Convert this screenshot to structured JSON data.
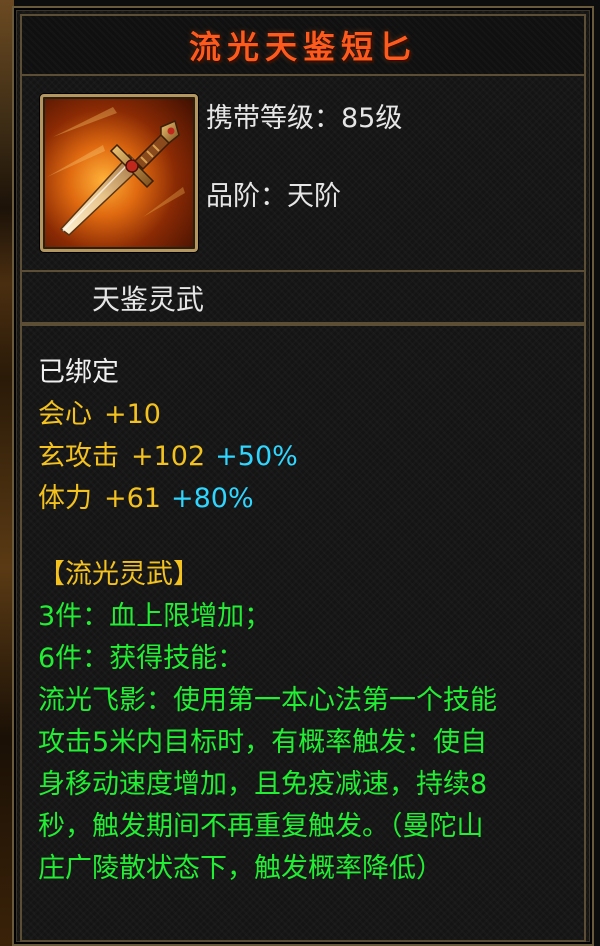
{
  "item": {
    "name": "流光天鉴短匕",
    "icon": "dagger-icon",
    "level_label": "携带等级：",
    "level_value": "85级",
    "grade_label": "品阶：",
    "grade_value": "天阶",
    "category": "天鉴灵武"
  },
  "attributes": {
    "bound": "已绑定",
    "stats": [
      {
        "name": "会心",
        "value": "+10",
        "bonus": ""
      },
      {
        "name": "玄攻击",
        "value": "+102",
        "bonus": "+50%"
      },
      {
        "name": "体力",
        "value": "+61",
        "bonus": "+80%"
      }
    ]
  },
  "set": {
    "name": "【流光灵武】",
    "lines": [
      "3件：血上限增加；",
      "6件：获得技能：",
      "流光飞影：使用第一本心法第一个技能",
      "攻击5米内目标时，有概率触发：使自",
      "身移动速度增加，且免疫减速，持续8",
      "秒，触发期间不再重复触发。（曼陀山",
      "庄广陵散状态下，触发概率降低）"
    ]
  },
  "colors": {
    "title": "#ff5a1e",
    "normal_text": "#e6e6e6",
    "stat_text": "#f3c21e",
    "bonus_text": "#2fd6ff",
    "set_text": "#22ee33",
    "border": "#5c4e34"
  }
}
